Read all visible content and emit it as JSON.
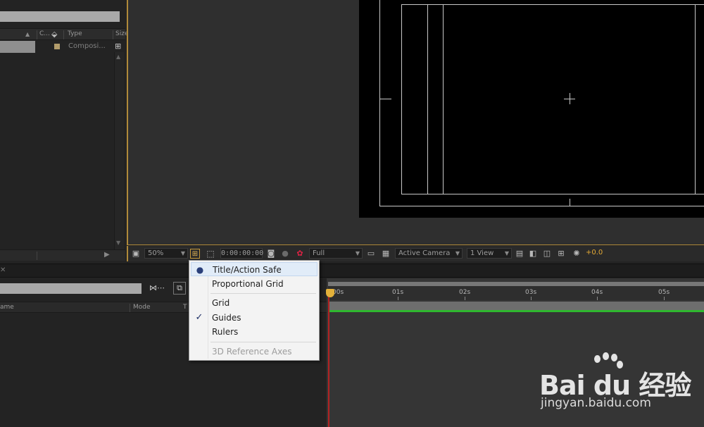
{
  "project_panel": {
    "columns": [
      "C...",
      "Type",
      "Size"
    ],
    "rows": [
      {
        "type": "Composi...",
        "label_color": "#b29c6b"
      }
    ]
  },
  "viewer": {
    "canvas_color": "#000000",
    "guide_color": "#c8c8c8"
  },
  "viewer_toolbar": {
    "magnification": "50%",
    "timecode": "0:00:00:00",
    "resolution": "Full",
    "camera": "Active Camera",
    "views": "1 View",
    "exposure": "+0.0",
    "exposure_color": "#e3a935"
  },
  "timeline": {
    "layer_columns": [
      "ame",
      "Mode",
      "T"
    ],
    "ruler_labels": [
      "00s",
      "01s",
      "02s",
      "03s",
      "04s",
      "05s"
    ],
    "playhead_color": "#e3b13a",
    "track_color": "#2fb82f"
  },
  "grid_menu": {
    "items": [
      {
        "label": "Title/Action Safe",
        "mark": "radio",
        "highlighted": true,
        "enabled": true
      },
      {
        "label": "Proportional Grid",
        "mark": "none",
        "enabled": true
      },
      {
        "label": "Grid",
        "mark": "none",
        "enabled": true
      },
      {
        "label": "Guides",
        "mark": "check",
        "enabled": true
      },
      {
        "label": "Rulers",
        "mark": "none",
        "enabled": true
      },
      {
        "label": "3D Reference Axes",
        "mark": "none",
        "enabled": false
      }
    ]
  },
  "watermark": {
    "logo": "Bai du 经验",
    "url": "jingyan.baidu.com"
  }
}
